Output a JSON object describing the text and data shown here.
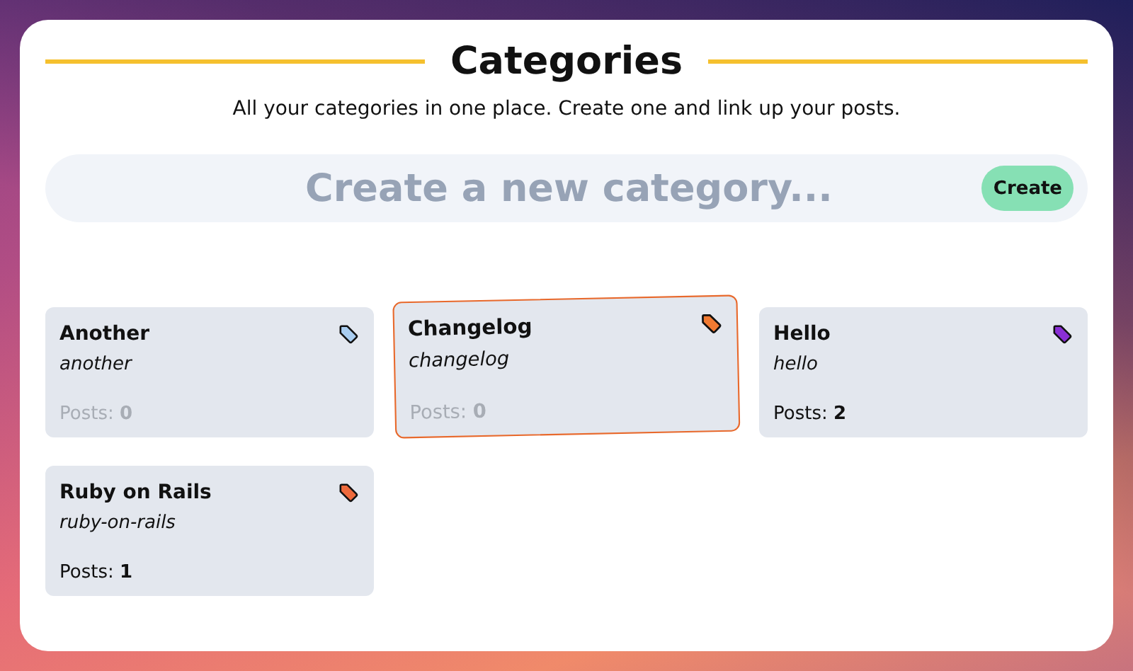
{
  "header": {
    "title": "Categories",
    "subtitle": "All your categories in one place. Create one and link up your posts."
  },
  "new_category": {
    "placeholder": "Create a new category...",
    "button": "Create"
  },
  "categories": [
    {
      "name": "Another",
      "slug": "another",
      "posts_label": "Posts:",
      "posts": "0",
      "color": "#a9cdf0",
      "muted": true,
      "selected": false
    },
    {
      "name": "Changelog",
      "slug": "changelog",
      "posts_label": "Posts:",
      "posts": "0",
      "color": "#f07a32",
      "muted": true,
      "selected": true
    },
    {
      "name": "Hello",
      "slug": "hello",
      "posts_label": "Posts:",
      "posts": "2",
      "color": "#8a2fd6",
      "muted": false,
      "selected": false
    },
    {
      "name": "Ruby on Rails",
      "slug": "ruby-on-rails",
      "posts_label": "Posts:",
      "posts": "1",
      "color": "#ee6a3c",
      "muted": false,
      "selected": false
    }
  ]
}
